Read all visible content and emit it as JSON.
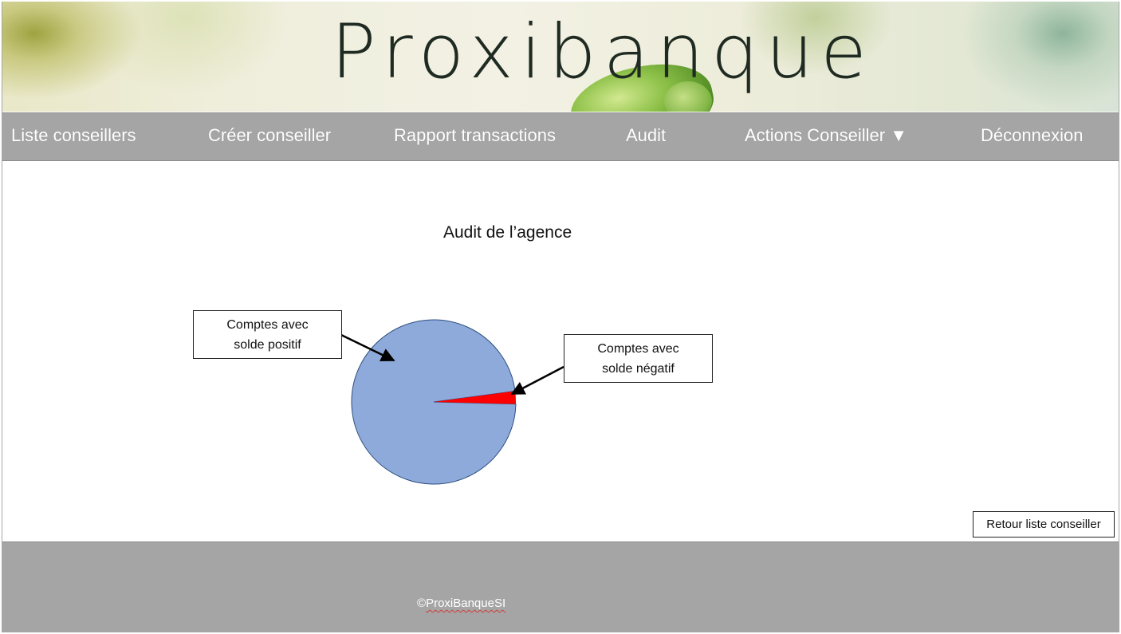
{
  "brand": {
    "name": "Proxibanque"
  },
  "nav": {
    "items": [
      {
        "label": "Liste conseillers"
      },
      {
        "label": "Créer conseiller"
      },
      {
        "label": "Rapport transactions"
      },
      {
        "label": "Audit"
      },
      {
        "label": "Actions Conseiller ▼"
      },
      {
        "label": "Déconnexion"
      }
    ]
  },
  "main": {
    "title": "Audit de l’agence",
    "callout_positive": {
      "line1": "Comptes avec",
      "line2": "solde positif"
    },
    "callout_negative": {
      "line1": "Comptes avec",
      "line2": "solde négatif"
    },
    "back_button": "Retour liste conseiller"
  },
  "chart_data": {
    "type": "pie",
    "slices": [
      {
        "label": "Comptes avec solde positif",
        "value": 97.5,
        "color": "#8eaadb"
      },
      {
        "label": "Comptes avec solde négatif",
        "value": 2.5,
        "color": "#ff0000"
      }
    ]
  },
  "footer": {
    "copyright_symbol": "©",
    "copyright_text": "ProxiBanqueSI"
  }
}
